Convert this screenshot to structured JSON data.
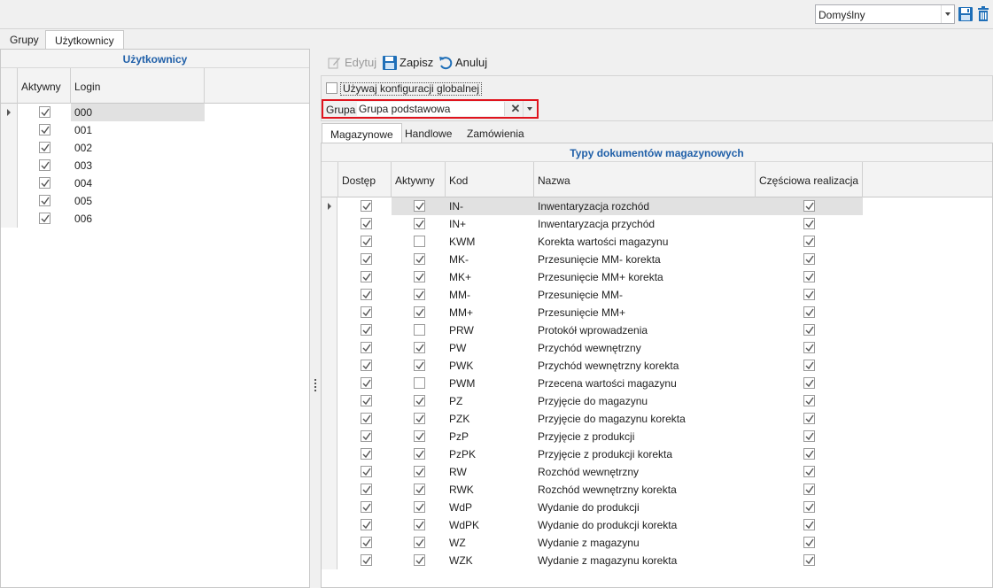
{
  "topbar": {
    "profile_value": "Domyślny",
    "save_icon": "save-icon",
    "delete_icon": "trash-icon"
  },
  "left_tabs": [
    {
      "label": "Grupy"
    },
    {
      "label": "Użytkownicy"
    }
  ],
  "users_panel": {
    "title": "Użytkownicy",
    "columns": [
      "Aktywny",
      "Login"
    ],
    "rows": [
      {
        "aktywny": true,
        "login": "000"
      },
      {
        "aktywny": true,
        "login": "001"
      },
      {
        "aktywny": true,
        "login": "002"
      },
      {
        "aktywny": true,
        "login": "003"
      },
      {
        "aktywny": true,
        "login": "004"
      },
      {
        "aktywny": true,
        "login": "005"
      },
      {
        "aktywny": true,
        "login": "006"
      }
    ]
  },
  "toolbar": {
    "edit_label": "Edytuj",
    "save_label": "Zapisz",
    "cancel_label": "Anuluj"
  },
  "config": {
    "global_label": "Używaj konfiguracji globalnej",
    "global_checked": false,
    "group_label": "Grupa",
    "group_value": "Grupa podstawowa"
  },
  "right_tabs": [
    {
      "label": "Magazynowe"
    },
    {
      "label": "Handlowe"
    },
    {
      "label": "Zamówienia"
    }
  ],
  "doc_types": {
    "title": "Typy dokumentów magazynowych",
    "columns": [
      "Dostęp",
      "Aktywny",
      "Kod",
      "Nazwa",
      "Częściowa realizacja"
    ],
    "rows": [
      {
        "dostep": true,
        "aktywny": true,
        "kod": "IN-",
        "nazwa": "Inwentaryzacja rozchód",
        "czesciowa": true
      },
      {
        "dostep": true,
        "aktywny": true,
        "kod": "IN+",
        "nazwa": "Inwentaryzacja przychód",
        "czesciowa": true
      },
      {
        "dostep": true,
        "aktywny": false,
        "kod": "KWM",
        "nazwa": "Korekta wartości magazynu",
        "czesciowa": true
      },
      {
        "dostep": true,
        "aktywny": true,
        "kod": "MK-",
        "nazwa": "Przesunięcie MM- korekta",
        "czesciowa": true
      },
      {
        "dostep": true,
        "aktywny": true,
        "kod": "MK+",
        "nazwa": "Przesunięcie MM+ korekta",
        "czesciowa": true
      },
      {
        "dostep": true,
        "aktywny": true,
        "kod": "MM-",
        "nazwa": "Przesunięcie MM-",
        "czesciowa": true
      },
      {
        "dostep": true,
        "aktywny": true,
        "kod": "MM+",
        "nazwa": "Przesunięcie MM+",
        "czesciowa": true
      },
      {
        "dostep": true,
        "aktywny": false,
        "kod": "PRW",
        "nazwa": "Protokół wprowadzenia",
        "czesciowa": true
      },
      {
        "dostep": true,
        "aktywny": true,
        "kod": "PW",
        "nazwa": "Przychód wewnętrzny",
        "czesciowa": true
      },
      {
        "dostep": true,
        "aktywny": true,
        "kod": "PWK",
        "nazwa": "Przychód wewnętrzny korekta",
        "czesciowa": true
      },
      {
        "dostep": true,
        "aktywny": false,
        "kod": "PWM",
        "nazwa": "Przecena wartości magazynu",
        "czesciowa": true
      },
      {
        "dostep": true,
        "aktywny": true,
        "kod": "PZ",
        "nazwa": "Przyjęcie do magazynu",
        "czesciowa": true
      },
      {
        "dostep": true,
        "aktywny": true,
        "kod": "PZK",
        "nazwa": "Przyjęcie do magazynu korekta",
        "czesciowa": true
      },
      {
        "dostep": true,
        "aktywny": true,
        "kod": "PzP",
        "nazwa": "Przyjęcie z produkcji",
        "czesciowa": true
      },
      {
        "dostep": true,
        "aktywny": true,
        "kod": "PzPK",
        "nazwa": "Przyjęcie z produkcji korekta",
        "czesciowa": true
      },
      {
        "dostep": true,
        "aktywny": true,
        "kod": "RW",
        "nazwa": "Rozchód wewnętrzny",
        "czesciowa": true
      },
      {
        "dostep": true,
        "aktywny": true,
        "kod": "RWK",
        "nazwa": "Rozchód wewnętrzny korekta",
        "czesciowa": true
      },
      {
        "dostep": true,
        "aktywny": true,
        "kod": "WdP",
        "nazwa": "Wydanie do produkcji",
        "czesciowa": true
      },
      {
        "dostep": true,
        "aktywny": true,
        "kod": "WdPK",
        "nazwa": "Wydanie do produkcji korekta",
        "czesciowa": true
      },
      {
        "dostep": true,
        "aktywny": true,
        "kod": "WZ",
        "nazwa": "Wydanie z magazynu",
        "czesciowa": true
      },
      {
        "dostep": true,
        "aktywny": true,
        "kod": "WZK",
        "nazwa": "Wydanie z magazynu korekta",
        "czesciowa": true
      }
    ]
  },
  "colors": {
    "title_blue": "#1f5fa8",
    "highlight_red": "#e0141e",
    "selected_row": "#e1e1e1"
  }
}
